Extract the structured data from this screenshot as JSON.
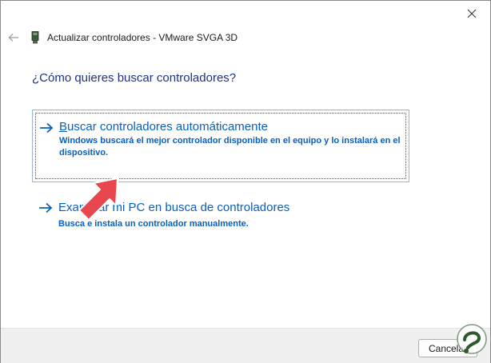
{
  "window": {
    "header_title": "Actualizar controladores - VMware SVGA 3D"
  },
  "question": "¿Cómo quieres buscar controladores?",
  "options": [
    {
      "title": "Buscar controladores automáticamente",
      "description": "Windows buscará el mejor controlador disponible en el equipo y lo instalará en el dispositivo."
    },
    {
      "title": "Examinar mi PC en busca de controladores",
      "description": "Busca e instala un controlador manualmente."
    }
  ],
  "footer": {
    "cancel_label": "Cancelar"
  },
  "colors": {
    "accent": "#0a5fbf",
    "question": "#1e3287",
    "annotation_arrow": "#e8474d"
  },
  "icons": [
    "close-icon",
    "back-arrow-icon",
    "device-icon",
    "right-arrow-icon",
    "annotation-arrow-icon",
    "watermark-logo"
  ]
}
